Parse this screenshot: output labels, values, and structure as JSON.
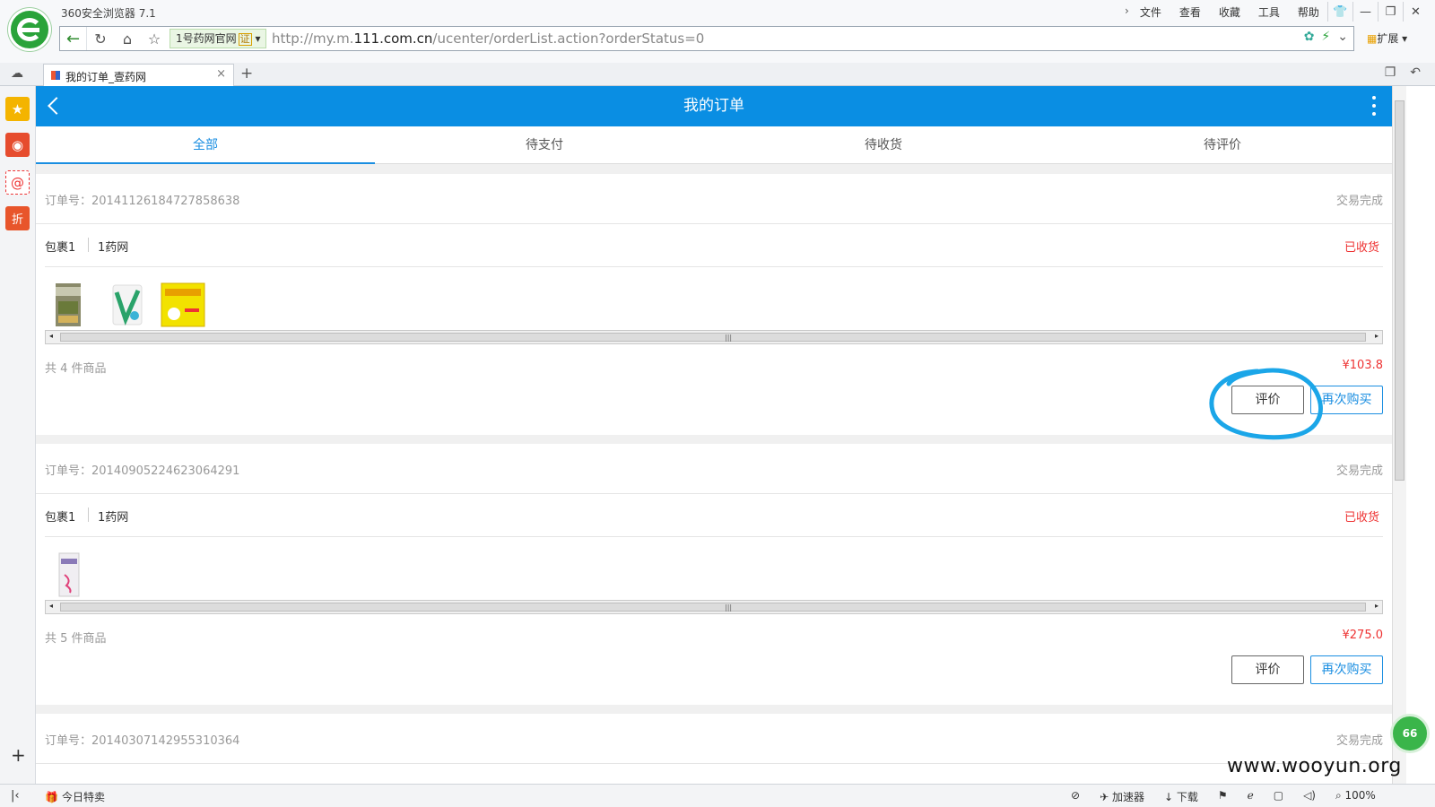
{
  "browser": {
    "app_title": "360安全浏览器 7.1",
    "menu": [
      "文件",
      "查看",
      "收藏",
      "工具",
      "帮助"
    ],
    "site_badge": "1号药网官网",
    "site_badge_mark": "证",
    "url_prefix": "http://my.m.",
    "url_domain": "111.com.cn",
    "url_path": "/ucenter/orderList.action?orderStatus=0",
    "extensions_label": "扩展",
    "tab_title": "我的订单_壹药网"
  },
  "page": {
    "title": "我的订单",
    "tabs": [
      {
        "label": "全部",
        "active": true
      },
      {
        "label": "待支付",
        "active": false
      },
      {
        "label": "待收货",
        "active": false
      },
      {
        "label": "待评价",
        "active": false
      }
    ]
  },
  "orders": [
    {
      "order_no": "订单号：20141126184727858638",
      "status": "交易完成",
      "package": "包裹1",
      "shop": "1药网",
      "package_status": "已收货",
      "count_text": "共 4 件商品",
      "total": "¥103.8",
      "review_label": "评价",
      "rebuy_label": "再次购买"
    },
    {
      "order_no": "订单号：20140905224623064291",
      "status": "交易完成",
      "package": "包裹1",
      "shop": "1药网",
      "package_status": "已收货",
      "count_text": "共 5 件商品",
      "total": "¥275.0",
      "review_label": "评价",
      "rebuy_label": "再次购买"
    },
    {
      "order_no": "订单号：20140307142955310364",
      "status": "交易完成"
    }
  ],
  "statusbar": {
    "deal_label": "今日特卖",
    "accelerator_label": "加速器",
    "download_label": "下载",
    "zoom": "100%"
  },
  "watermark": "www.wooyun.org",
  "float_badge": "66",
  "colors": {
    "accent": "#0a8ee3",
    "price": "#e33333",
    "annotation": "#1ba6e8"
  },
  "icons": [
    "back-icon",
    "refresh-icon",
    "home-icon",
    "star-icon",
    "more-icon",
    "cloud-icon",
    "weibo-icon",
    "mail-icon",
    "discount-icon"
  ]
}
